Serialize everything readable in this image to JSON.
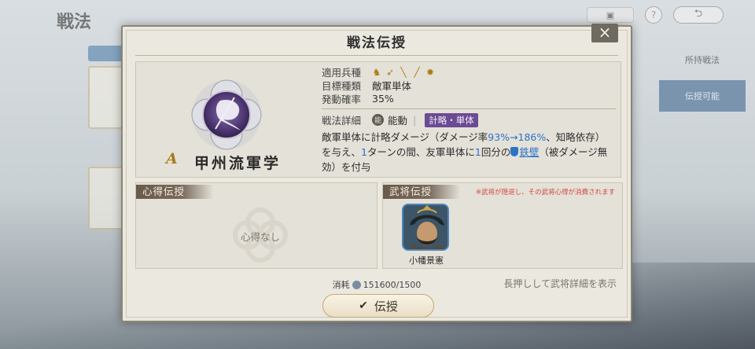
{
  "background": {
    "title": "戦法",
    "right_items": [
      "所持戦法",
      "伝授可能"
    ],
    "return_icon": "undo-arrow"
  },
  "modal": {
    "title": "戦法伝授",
    "close_label": "×"
  },
  "skill": {
    "rank": "A",
    "name": "甲州流軍学",
    "troop_label": "適用兵種",
    "troop_icons": [
      "cavalry-icon",
      "bow-icon",
      "gun-icon",
      "spear-icon",
      "siege-icon"
    ],
    "target_label": "目標種類",
    "target_value": "敵軍単体",
    "rate_label": "発動確率",
    "rate_value": "35%",
    "detail_label": "戦法詳細",
    "ability_icon_text": "能",
    "ability_type": "能動",
    "type_badge": "計略・単体",
    "desc": {
      "p1": "敵軍単体に計略ダメージ（ダメージ率",
      "p2": "93%→186%",
      "p3": "、知略依存）を与え、",
      "p4": "1",
      "p5": "ターンの間、友軍単体に",
      "p6": "1",
      "p7": "回分の",
      "p8": "鉄壁",
      "p9": "（被ダメージ無効）を付与"
    }
  },
  "heart_panel": {
    "tag": "心得伝授",
    "empty_text": "心得なし"
  },
  "general_panel": {
    "tag": "武将伝授",
    "warning": "※武将が隠退し、その武将心得が消費されます",
    "general_name": "小幡景憲"
  },
  "footer": {
    "cost_label": "消耗",
    "cost_value": "151600/1500",
    "hint": "長押しして武将詳細を表示",
    "transfer_label": "伝授"
  },
  "colors": {
    "accent_purple": "#6b4b93",
    "highlight_blue": "#2a74c6",
    "warning_red": "#d24a3b",
    "rank_gold": "#a67a1e"
  }
}
